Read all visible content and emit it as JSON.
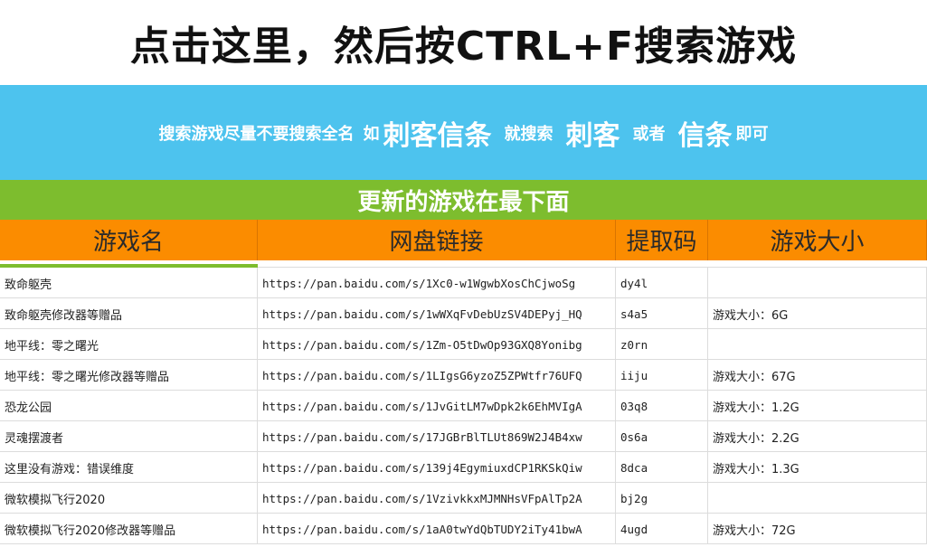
{
  "title": "点击这里，然后按CTRL+F搜索游戏",
  "tip": {
    "part1": "搜索游戏尽量不要搜索全名",
    "part2": "如",
    "example_full": "刺客信条",
    "part3": "就搜索",
    "example_a": "刺客",
    "part4": "或者",
    "example_b": "信条",
    "part5": "即可"
  },
  "notice": "更新的游戏在最下面",
  "columns": [
    "游戏名",
    "网盘链接",
    "提取码",
    "游戏大小"
  ],
  "rows": [
    {
      "name": "致命躯壳",
      "link": "https://pan.baidu.com/s/1Xc0-w1WgwbXosChCjwoSg",
      "code": "dy4l",
      "size": ""
    },
    {
      "name": "致命躯壳修改器等赠品",
      "link": "https://pan.baidu.com/s/1wWXqFvDebUzSV4DEPyj_HQ",
      "code": "s4a5",
      "size": "游戏大小：6G"
    },
    {
      "name": "地平线：零之曙光",
      "link": "https://pan.baidu.com/s/1Zm-O5tDwOp93GXQ8Yonibg",
      "code": "z0rn",
      "size": ""
    },
    {
      "name": "地平线：零之曙光修改器等赠品",
      "link": "https://pan.baidu.com/s/1LIgsG6yzoZ5ZPWtfr76UFQ",
      "code": "iiju",
      "size": "游戏大小：67G"
    },
    {
      "name": "恐龙公园",
      "link": "https://pan.baidu.com/s/1JvGitLM7wDpk2k6EhMVIgA",
      "code": "03q8",
      "size": "游戏大小：1.2G"
    },
    {
      "name": "灵魂摆渡者",
      "link": "https://pan.baidu.com/s/17JGBrBlTLUt869W2J4B4xw",
      "code": "0s6a",
      "size": "游戏大小：2.2G"
    },
    {
      "name": "这里没有游戏：错误维度",
      "link": "https://pan.baidu.com/s/139j4EgymiuxdCP1RKSkQiw",
      "code": "8dca",
      "size": "游戏大小：1.3G"
    },
    {
      "name": "微软模拟飞行2020",
      "link": "https://pan.baidu.com/s/1VzivkkxMJMNHsVFpAlTp2A",
      "code": "bj2g",
      "size": ""
    },
    {
      "name": "微软模拟飞行2020修改器等赠品",
      "link": "https://pan.baidu.com/s/1aA0twYdQbTUDY2iTy41bwA",
      "code": "4ugd",
      "size": "游戏大小：72G"
    }
  ]
}
